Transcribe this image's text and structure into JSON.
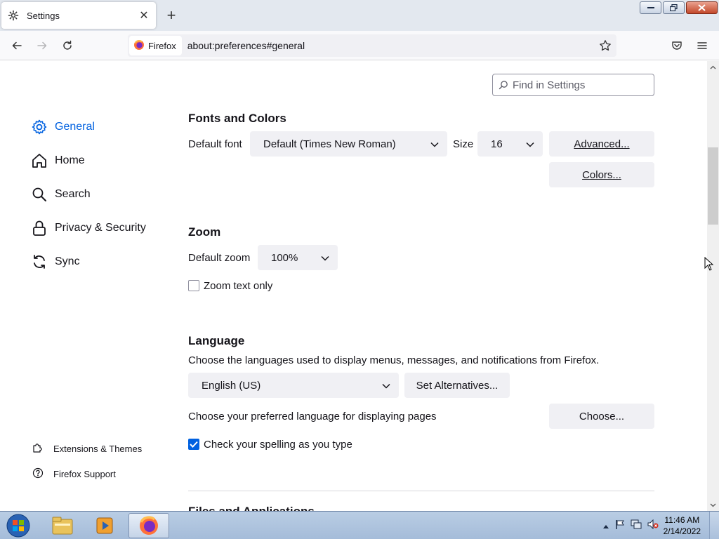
{
  "browser": {
    "tab_title": "Settings",
    "identity_label": "Firefox",
    "url": "about:preferences#general"
  },
  "search": {
    "placeholder": "Find in Settings"
  },
  "sidebar": {
    "items": [
      {
        "label": "General",
        "icon": "gear-icon",
        "selected": true
      },
      {
        "label": "Home",
        "icon": "home-icon"
      },
      {
        "label": "Search",
        "icon": "search-icon"
      },
      {
        "label": "Privacy & Security",
        "icon": "lock-icon"
      },
      {
        "label": "Sync",
        "icon": "sync-icon"
      }
    ],
    "footer": [
      {
        "label": "Extensions & Themes",
        "icon": "puzzle-icon"
      },
      {
        "label": "Firefox Support",
        "icon": "help-icon"
      }
    ]
  },
  "fonts": {
    "heading": "Fonts and Colors",
    "default_font_label": "Default font",
    "default_font_value": "Default (Times New Roman)",
    "size_label": "Size",
    "size_value": "16",
    "advanced_button": "Advanced...",
    "colors_button": "Colors..."
  },
  "zoom": {
    "heading": "Zoom",
    "default_zoom_label": "Default zoom",
    "default_zoom_value": "100%",
    "zoom_text_only_label": "Zoom text only",
    "zoom_text_only_checked": false
  },
  "language": {
    "heading": "Language",
    "description": "Choose the languages used to display menus, messages, and notifications from Firefox.",
    "language_value": "English (US)",
    "set_alternatives_button": "Set Alternatives...",
    "preferred_label": "Choose your preferred language for displaying pages",
    "choose_button": "Choose...",
    "spellcheck_label": "Check your spelling as you type",
    "spellcheck_checked": true
  },
  "next_section_heading": "Files and Applications",
  "taskbar": {
    "time": "11:46 AM",
    "date": "2/14/2022"
  },
  "colors": {
    "accent": "#0061e0",
    "button_bg": "#f0f0f4"
  }
}
